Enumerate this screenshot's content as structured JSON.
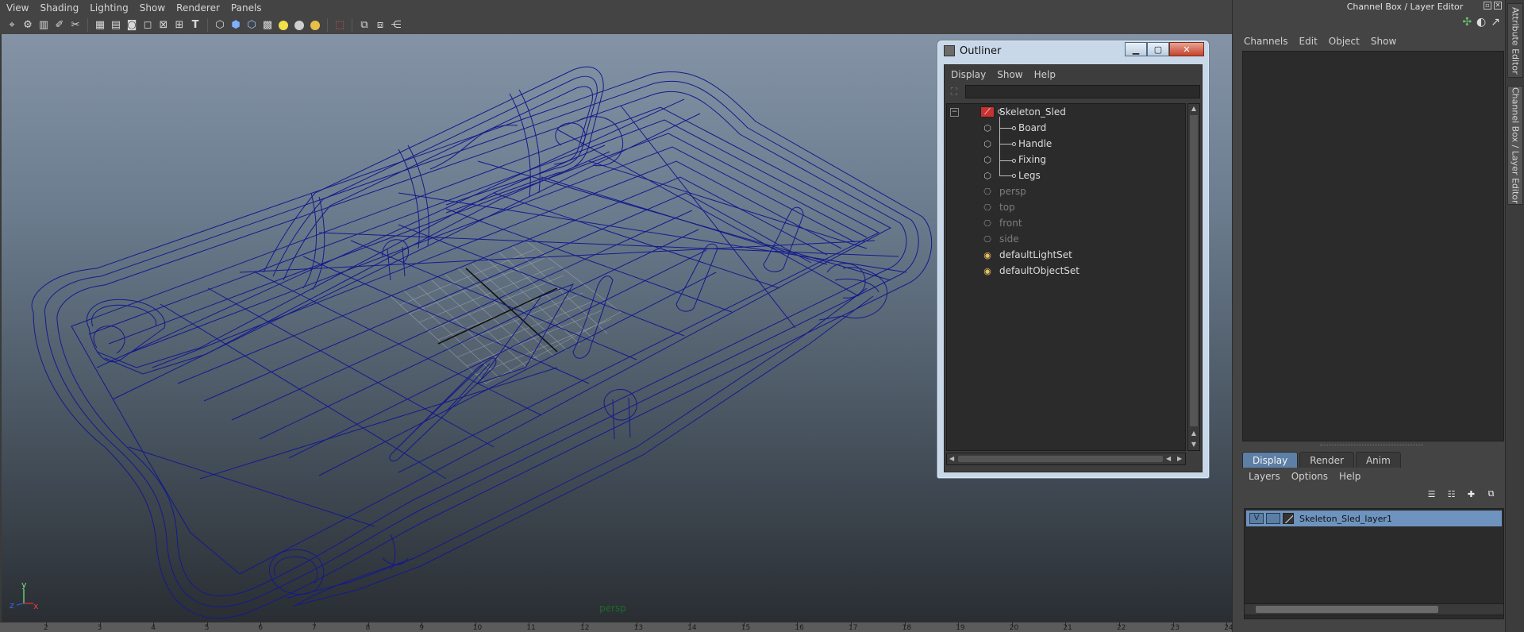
{
  "menubar": {
    "items": [
      "View",
      "Shading",
      "Lighting",
      "Show",
      "Renderer",
      "Panels"
    ]
  },
  "toolbar": {
    "icons": [
      "camera-select-icon",
      "camera-attributes-icon",
      "bookmark-icon",
      "image-plane-icon",
      "grid-icon",
      "film-gate-icon",
      "wireframe-icon",
      "smooth-shade-icon",
      "flat-shade-icon",
      "bounding-box-icon",
      "xray-icon",
      "textured-icon",
      "default-light-icon",
      "isolate-select-icon",
      "shadows-icon"
    ]
  },
  "viewport": {
    "camera_label": "persp",
    "axis": {
      "y": "y",
      "x": "x",
      "z": "z"
    },
    "colors": {
      "wireframe": "#141a8c",
      "grid": "#c0c0c0",
      "axis_y": "#6dd66d",
      "axis_x": "#d63030",
      "axis_z": "#2a5ad6",
      "camera_label": "#1e6a2a"
    }
  },
  "timeline": {
    "ticks": [
      "2",
      "3",
      "4",
      "5",
      "6",
      "7",
      "8",
      "9",
      "10",
      "11",
      "12",
      "13",
      "14",
      "15",
      "16",
      "17",
      "18",
      "19",
      "20",
      "21",
      "22",
      "23",
      "24"
    ]
  },
  "right_panel": {
    "title": "Channel Box / Layer Editor",
    "channel_menus": [
      "Channels",
      "Edit",
      "Object",
      "Show"
    ],
    "layer_tabs": [
      {
        "label": "Display",
        "active": true
      },
      {
        "label": "Render",
        "active": false
      },
      {
        "label": "Anim",
        "active": false
      }
    ],
    "layer_menus": [
      "Layers",
      "Options",
      "Help"
    ],
    "layer": {
      "visible": "V",
      "name": "Skeleton_Sled_layer1"
    }
  },
  "side_tabs": {
    "attribute_editor": "Attribute Editor",
    "channel_box": "Channel Box / Layer Editor"
  },
  "outliner": {
    "title": "Outliner",
    "menus": [
      "Display",
      "Show",
      "Help"
    ],
    "expand_symbol": "−",
    "nodes": [
      {
        "label": "Skeleton_Sled",
        "icon": "group-transform-icon",
        "level": 0,
        "dim": false
      },
      {
        "label": "Board",
        "icon": "mesh-transform-icon",
        "level": 1,
        "dim": false
      },
      {
        "label": "Handle",
        "icon": "mesh-transform-icon",
        "level": 1,
        "dim": false
      },
      {
        "label": "Fixing",
        "icon": "mesh-transform-icon",
        "level": 1,
        "dim": false
      },
      {
        "label": "Legs",
        "icon": "mesh-transform-icon",
        "level": 1,
        "dim": false
      },
      {
        "label": "persp",
        "icon": "camera-icon",
        "level": 0,
        "dim": true
      },
      {
        "label": "top",
        "icon": "camera-icon",
        "level": 0,
        "dim": true
      },
      {
        "label": "front",
        "icon": "camera-icon",
        "level": 0,
        "dim": true
      },
      {
        "label": "side",
        "icon": "camera-icon",
        "level": 0,
        "dim": true
      },
      {
        "label": "defaultLightSet",
        "icon": "set-icon",
        "level": 0,
        "dim": false
      },
      {
        "label": "defaultObjectSet",
        "icon": "set-icon",
        "level": 0,
        "dim": false
      }
    ]
  }
}
